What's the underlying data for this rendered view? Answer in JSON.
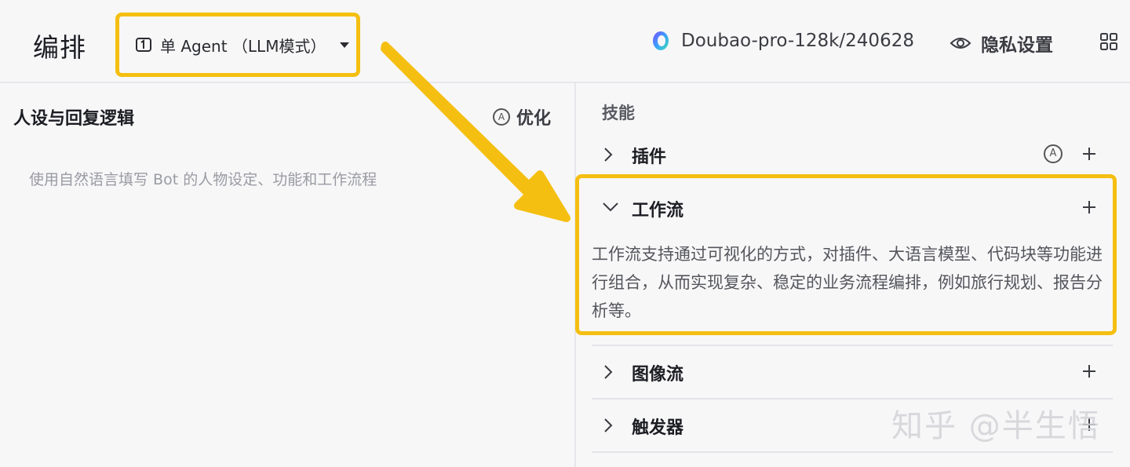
{
  "header": {
    "title": "编排",
    "mode_label": "单 Agent （LLM模式）",
    "model_name": "Doubao-pro-128k/240628",
    "privacy_label": "隐私设置"
  },
  "left": {
    "persona_title": "人设与回复逻辑",
    "optimize_label": "优化",
    "persona_placeholder": "使用自然语言填写 Bot 的人物设定、功能和工作流程"
  },
  "skills": {
    "title": "技能",
    "plugin_label": "插件",
    "workflow_label": "工作流",
    "workflow_desc": "工作流支持通过可视化的方式，对插件、大语言模型、代码块等功能进行组合，从而实现复杂、稳定的业务流程编排，例如旅行规划、报告分析等。",
    "imageflow_label": "图像流",
    "trigger_label": "触发器"
  },
  "auto_badge": "A",
  "watermark": "知乎 @半生悟",
  "colors": {
    "highlight": "#f5bf11",
    "background": "#f7f7f8"
  },
  "icons": [
    "agent-mode-icon",
    "dropdown-caret-icon",
    "model-logo-icon",
    "eye-icon",
    "grid-apps-icon",
    "auto-a-icon",
    "chevron-right-icon",
    "chevron-down-icon",
    "plus-icon",
    "arrow-annotation"
  ]
}
